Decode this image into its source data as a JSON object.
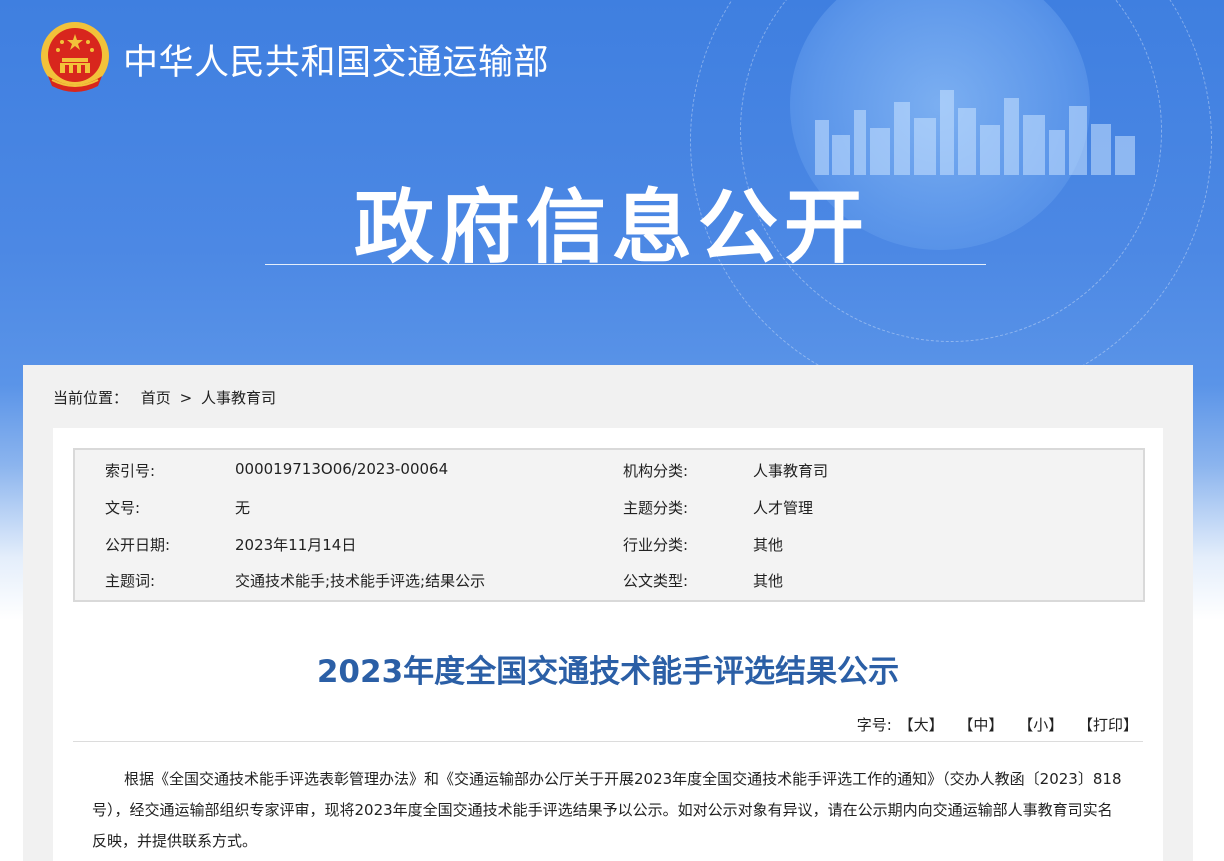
{
  "header": {
    "ministry_name": "中华人民共和国交通运输部",
    "section_title": "政府信息公开"
  },
  "breadcrumb": {
    "label": "当前位置：",
    "items": [
      "首页",
      "人事教育司"
    ],
    "separator": ">"
  },
  "meta": {
    "rows": [
      {
        "label1": "索引号:",
        "value1": "000019713O06/2023-00064",
        "label2": "机构分类:",
        "value2": "人事教育司"
      },
      {
        "label1": "文号:",
        "value1": "无",
        "label2": "主题分类:",
        "value2": "人才管理"
      },
      {
        "label1": "公开日期:",
        "value1": "2023年11月14日",
        "label2": "行业分类:",
        "value2": "其他"
      },
      {
        "label1": "主题词:",
        "value1": "交通技术能手;技术能手评选;结果公示",
        "label2": "公文类型:",
        "value2": "其他"
      }
    ]
  },
  "document": {
    "title": "2023年度全国交通技术能手评选结果公示",
    "font_size_label": "字号:",
    "font_large": "【大】",
    "font_medium": "【中】",
    "font_small": "【小】",
    "print": "【打印】",
    "body": "根据《全国交通技术能手评选表彰管理办法》和《交通运输部办公厅关于开展2023年度全国交通技术能手评选工作的通知》（交办人教函〔2023〕818号），经交通运输部组织专家评审，现将2023年度全国交通技术能手评选结果予以公示。如对公示对象有异议，请在公示期内向交通运输部人事教育司实名反映，并提供联系方式。"
  },
  "colors": {
    "header_blue": "#4a86e3",
    "title_blue": "#2b5fa6",
    "panel_gray": "#f1f1f1",
    "emblem_red": "#d8261d",
    "emblem_gold": "#f2c23a"
  }
}
